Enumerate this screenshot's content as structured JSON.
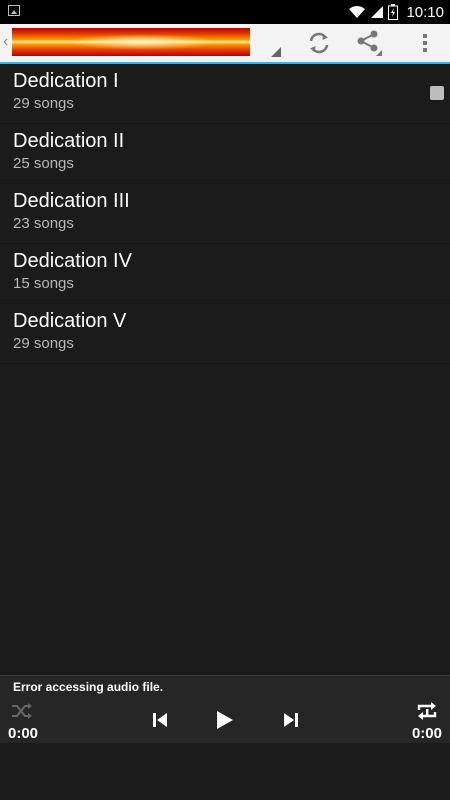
{
  "status_bar": {
    "time": "10:10",
    "icons": [
      "image-notification-icon",
      "wifi-icon",
      "signal-icon",
      "battery-icon"
    ]
  },
  "action_bar": {
    "icons": [
      "back-caret-icon",
      "app-logo",
      "refresh-icon",
      "share-icon",
      "overflow-menu-icon"
    ],
    "accent_color": "#33b5e5"
  },
  "playlists": [
    {
      "title": "Dedication I",
      "subtitle": "29 songs"
    },
    {
      "title": "Dedication II",
      "subtitle": "25 songs"
    },
    {
      "title": "Dedication III",
      "subtitle": "23 songs"
    },
    {
      "title": "Dedication IV",
      "subtitle": "15 songs"
    },
    {
      "title": "Dedication V",
      "subtitle": "29 songs"
    }
  ],
  "player": {
    "message": "Error accessing audio file.",
    "elapsed": "0:00",
    "duration": "0:00",
    "controls": [
      "shuffle-icon",
      "previous-icon",
      "play-icon",
      "next-icon",
      "repeat-one-icon"
    ]
  }
}
